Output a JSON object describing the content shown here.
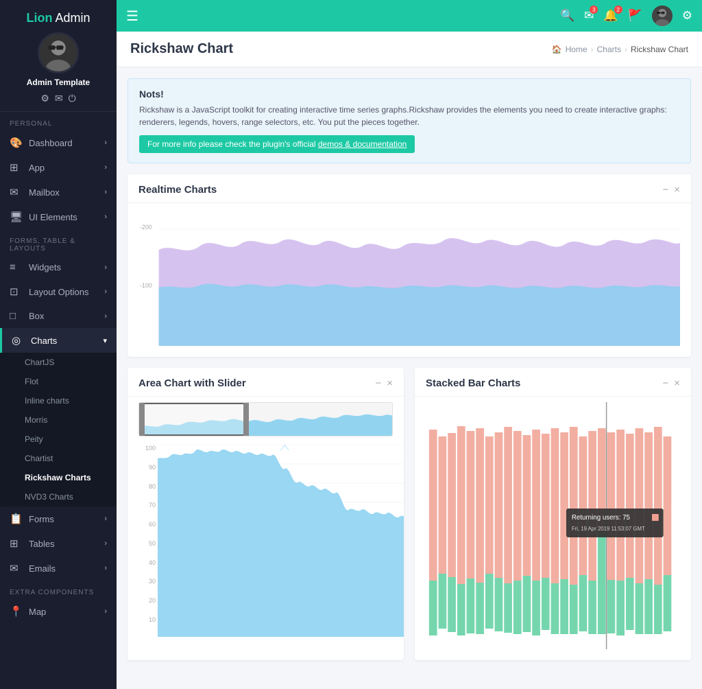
{
  "app": {
    "name_part1": "Lion",
    "name_part2": " Admin"
  },
  "sidebar": {
    "username": "Admin Template",
    "section_personal": "PERSONAL",
    "section_forms": "FORMS, TABLE & LAYOUTS",
    "section_extra": "EXTRA COMPONENTS",
    "items_personal": [
      {
        "label": "Dashboard",
        "icon": "🎨",
        "has_sub": true
      },
      {
        "label": "App",
        "icon": "⊞",
        "has_sub": true
      },
      {
        "label": "Mailbox",
        "icon": "✉",
        "has_sub": true
      },
      {
        "label": "UI Elements",
        "icon": "🖥",
        "has_sub": true
      }
    ],
    "items_forms": [
      {
        "label": "Widgets",
        "icon": "≡",
        "has_sub": true
      },
      {
        "label": "Layout Options",
        "icon": "⊡",
        "has_sub": true
      },
      {
        "label": "Box",
        "icon": "□",
        "has_sub": true
      },
      {
        "label": "Charts",
        "icon": "◎",
        "has_sub": true,
        "active": true
      }
    ],
    "charts_sub": [
      {
        "label": "ChartJS",
        "active": false
      },
      {
        "label": "Flot",
        "active": false
      },
      {
        "label": "Inline charts",
        "active": false
      },
      {
        "label": "Morris",
        "active": false
      },
      {
        "label": "Peity",
        "active": false
      },
      {
        "label": "Chartist",
        "active": false
      },
      {
        "label": "Rickshaw Charts",
        "active": true
      },
      {
        "label": "NVD3 Charts",
        "active": false
      }
    ],
    "items_extra": [
      {
        "label": "Forms",
        "icon": "📋",
        "has_sub": true
      },
      {
        "label": "Tables",
        "icon": "⊞",
        "has_sub": true
      },
      {
        "label": "Emails",
        "icon": "✉",
        "has_sub": true
      },
      {
        "label": "Map",
        "icon": "📍",
        "has_sub": true
      }
    ]
  },
  "topbar": {
    "hamburger": "☰"
  },
  "page": {
    "title": "Rickshaw Chart",
    "breadcrumb": {
      "home": "Home",
      "charts": "Charts",
      "current": "Rickshaw Chart"
    }
  },
  "note": {
    "title": "Nots!",
    "text": "Rickshaw is a JavaScript toolkit for creating interactive time series graphs.Rickshaw provides the elements you need to create interactive graphs: renderers, legends, hovers, range selectors, etc. You put the pieces together.",
    "link_text": "For more info please check the plugin's official ",
    "link_label": "demos & documentation"
  },
  "cards": {
    "realtime": {
      "title": "Realtime Charts",
      "minimize": "−",
      "close": "×"
    },
    "area": {
      "title": "Area Chart with Slider",
      "minimize": "−",
      "close": "×"
    },
    "stacked": {
      "title": "Stacked Bar Charts",
      "minimize": "−",
      "close": "×",
      "tooltip": {
        "label": "Returning users: 75",
        "date": "Fri, 19 Apr 2019 11:53:07 GMT"
      }
    }
  },
  "chart_yaxis": {
    "realtime": [
      "-200",
      "-100"
    ],
    "area_top": [],
    "area_bottom": [
      "100",
      "90",
      "80",
      "70",
      "60",
      "50",
      "40",
      "30",
      "20",
      "10"
    ]
  }
}
